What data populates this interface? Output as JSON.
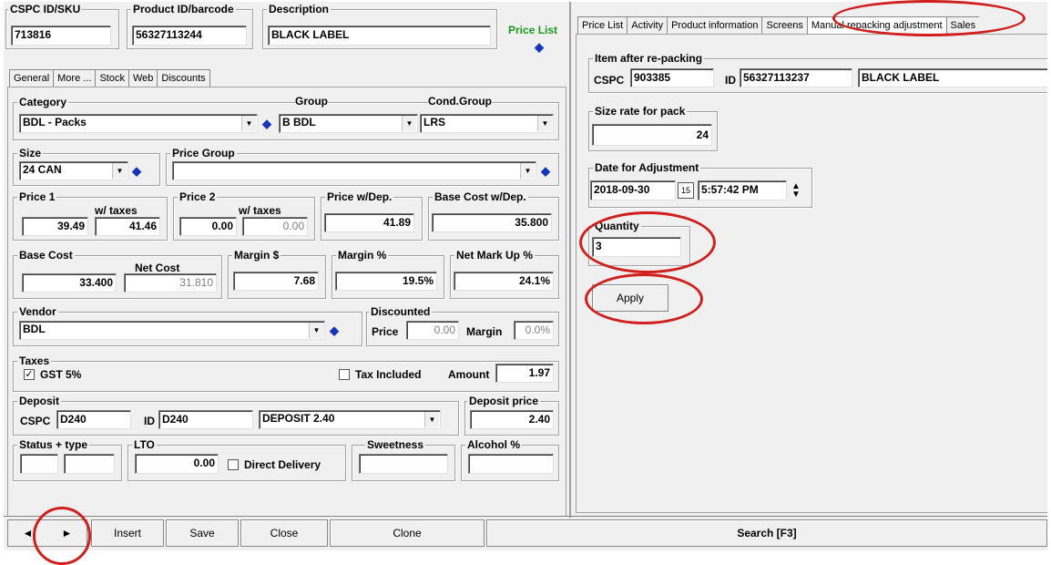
{
  "header": {
    "sku_label": "CSPC ID/SKU",
    "sku_value": "713816",
    "barcode_label": "Product ID/barcode",
    "barcode_value": "56327113244",
    "desc_label": "Description",
    "desc_value": "BLACK LABEL",
    "price_list": "Price List"
  },
  "left_tabs": [
    "General",
    "More ...",
    "Stock",
    "Web",
    "Discounts"
  ],
  "classification": {
    "category_label": "Category",
    "category_value": "BDL - Packs",
    "group_label": "Group",
    "group_value": "B BDL",
    "cond_label": "Cond.Group",
    "cond_value": "LRS",
    "size_label": "Size",
    "size_value": "24 CAN",
    "pricegroup_label": "Price Group",
    "pricegroup_value": ""
  },
  "prices": {
    "price1_label": "Price 1",
    "wtax1_label": "w/ taxes",
    "price1": "39.49",
    "price1_tax": "41.46",
    "price2_label": "Price 2",
    "wtax2_label": "w/ taxes",
    "price2": "0.00",
    "price2_tax": "0.00",
    "pricedep_label": "Price w/Dep.",
    "pricedep": "41.89",
    "basecostdep_label": "Base Cost w/Dep.",
    "basecostdep": "35.800"
  },
  "costs": {
    "basecost_label": "Base Cost",
    "basecost": "33.400",
    "netcost_label": "Net Cost",
    "netcost": "31.810",
    "margin_label": "Margin $",
    "margin": "7.68",
    "marginpct_label": "Margin %",
    "marginpct": "19.5%",
    "markup_label": "Net Mark Up %",
    "markup": "24.1%"
  },
  "vendor": {
    "vendor_label": "Vendor",
    "vendor_value": "BDL",
    "discounted_label": "Discounted",
    "price_label": "Price",
    "price_value": "0.00",
    "margin_label": "Margin",
    "margin_value": "0.0%"
  },
  "taxes": {
    "label": "Taxes",
    "gst_label": "GST 5%",
    "gst_checked": "✓",
    "included_label": "Tax Included",
    "amount_label": "Amount",
    "amount_value": "1.97"
  },
  "deposit": {
    "label": "Deposit",
    "cspc_label": "CSPC",
    "cspc_value": "D240",
    "id_label": "ID",
    "id_value": "D240",
    "name_value": "DEPOSIT 2.40",
    "price_label": "Deposit price",
    "price_value": "2.40"
  },
  "misc": {
    "status_label": "Status + type",
    "lto_label": "LTO",
    "lto_value": "0.00",
    "direct_label": "Direct Delivery",
    "sweetness_label": "Sweetness",
    "alcohol_label": "Alcohol %"
  },
  "right_tabs": [
    "Price List",
    "Activity",
    "Product information",
    "Screens",
    "Manual repacking adjustment",
    "Sales"
  ],
  "repack": {
    "item_label": "Item after re-packing",
    "cspc_label": "CSPC",
    "cspc_value": "903385",
    "id_label": "ID",
    "id_value": "56327113237",
    "name_value": "BLACK LABEL",
    "size_label": "Size rate for pack",
    "size_value": "24",
    "date_label": "Date for Adjustment",
    "date_value": "2018-09-30",
    "time_value": "5:57:42 PM",
    "qty_label": "Quantity",
    "qty_value": "3",
    "apply_label": "Apply"
  },
  "toolbar": {
    "insert": "Insert",
    "save": "Save",
    "close": "Close",
    "clone": "Clone",
    "search": "Search [F3]"
  },
  "colors": {
    "price_list": "#1a9a1a",
    "annotation": "#d0201e",
    "icon_blue": "#1535b8"
  }
}
